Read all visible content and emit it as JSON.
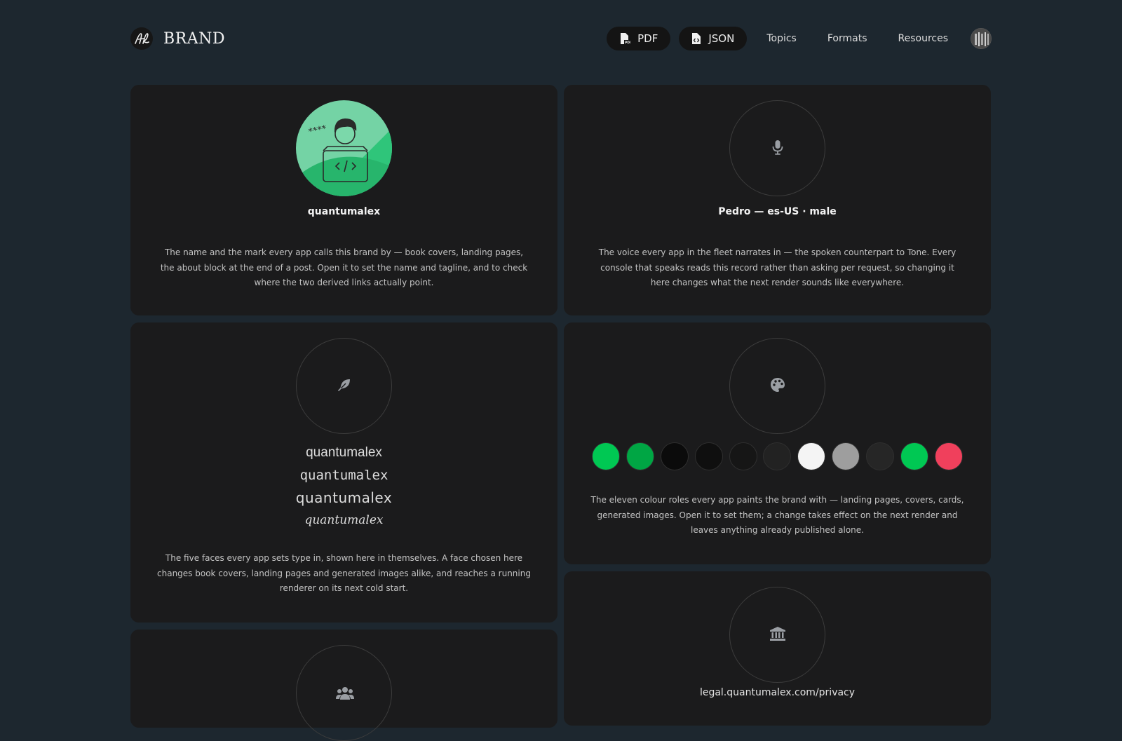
{
  "header": {
    "brand_name": "BRAND",
    "nav": {
      "pdf_label": "PDF",
      "json_label": "JSON",
      "links": [
        "Topics",
        "Formats",
        "Resources"
      ]
    }
  },
  "cards": {
    "identity": {
      "title": "quantumalex",
      "description": "The name and the mark every app calls this brand by — book covers, landing pages, the about block at the end of a post. Open it to set the name and tagline, and to check where the two derived links actually point."
    },
    "voice": {
      "title": "Pedro — es-US · male",
      "description": "The voice every app in the fleet narrates in — the spoken counterpart to Tone. Every console that speaks reads this record rather than asking per request, so changing it here changes what the next render sounds like everywhere."
    },
    "typography": {
      "samples": [
        "quantumalex",
        "quantumalex",
        "quantumalex",
        "quantumalex"
      ],
      "description": "The five faces every app sets type in, shown here in themselves. A face chosen here changes book covers, landing pages and generated images alike, and reaches a running renderer on its next cold start."
    },
    "colors": {
      "swatches": [
        "#00c853",
        "#00a644",
        "#0b0b0b",
        "#0f0f0f",
        "#161616",
        "#222222",
        "#f4f4f4",
        "#9e9e9e",
        "#262626",
        "#00c853",
        "#f0405c"
      ],
      "description": "The eleven colour roles every app paints the brand with — landing pages, covers, cards, generated images. Open it to set them; a change takes effect on the next render and leaves anything already published alone."
    },
    "legal": {
      "url": "legal.quantumalex.com/privacy"
    }
  },
  "colors": {
    "background": "#1d272f",
    "card": "#1b1b1c",
    "accent": "#2ecc71"
  }
}
